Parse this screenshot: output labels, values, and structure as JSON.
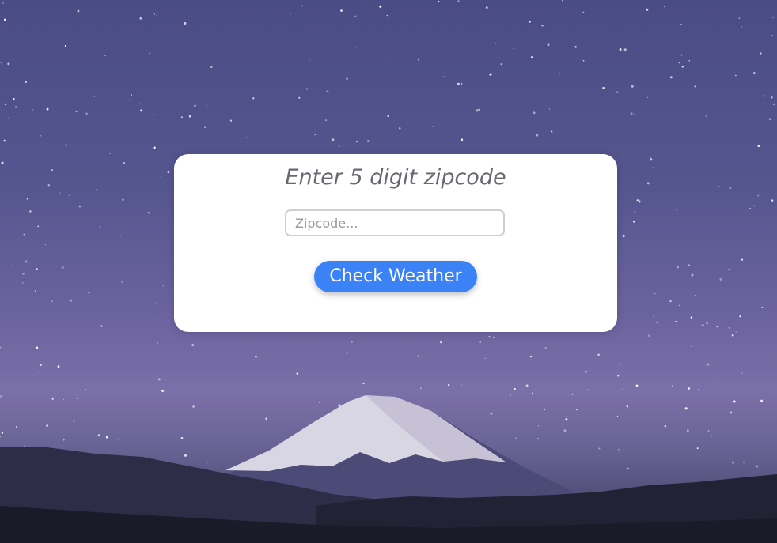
{
  "form": {
    "title": "Enter 5 digit zipcode",
    "zip_value": "",
    "zip_placeholder": "Zipcode...",
    "button_label": "Check Weather"
  },
  "colors": {
    "button": "#3b82f6",
    "card": "#ffffff",
    "title_text": "#666a70"
  }
}
